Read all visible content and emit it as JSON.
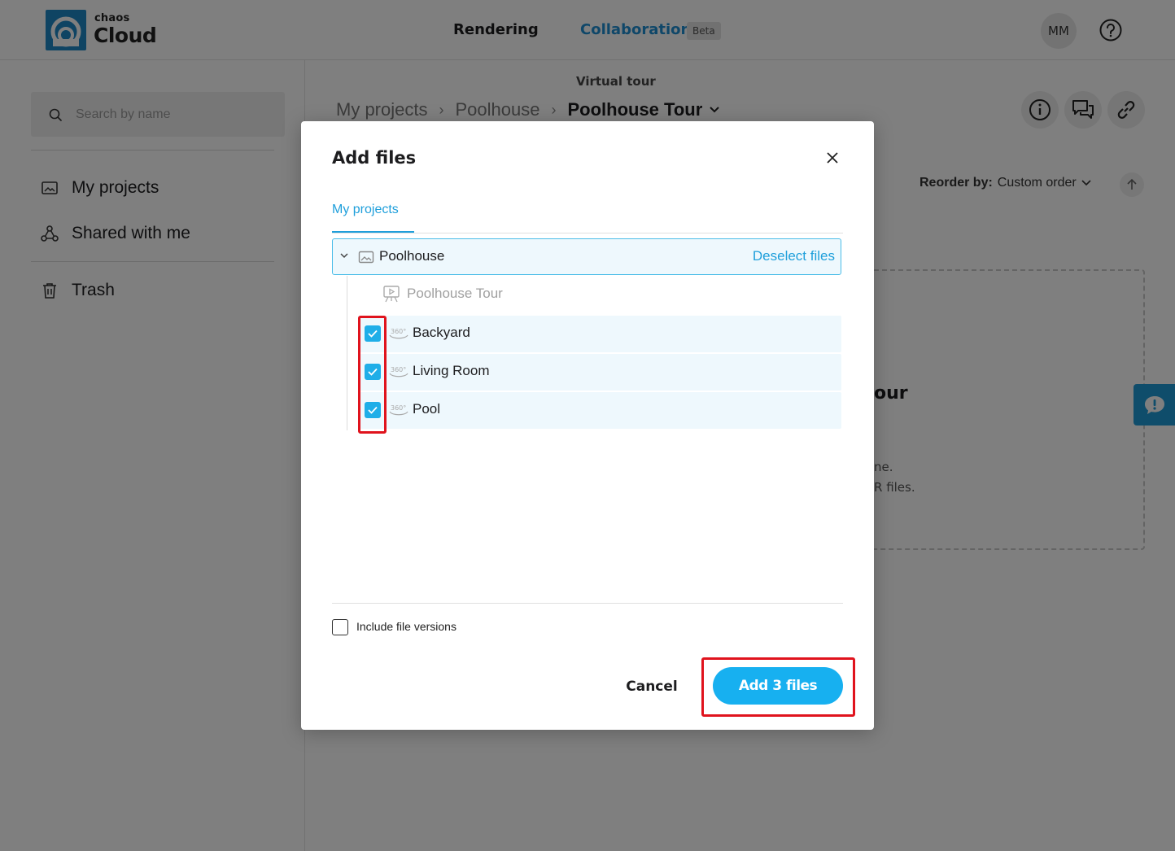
{
  "header": {
    "logo_small": "chaos",
    "logo_big": "Cloud",
    "nav_rendering": "Rendering",
    "nav_collaboration": "Collaboration",
    "beta_badge": "Beta",
    "avatar_initials": "MM",
    "help_icon": "help-circle-icon"
  },
  "sidebar": {
    "search_placeholder": "Search by name",
    "items": [
      {
        "label": "My projects",
        "icon": "image-folder-icon"
      },
      {
        "label": "Shared with me",
        "icon": "share-nodes-icon"
      },
      {
        "label": "Trash",
        "icon": "trash-icon"
      }
    ]
  },
  "main": {
    "subtitle": "Virtual tour",
    "breadcrumb": [
      "My projects",
      "Poolhouse",
      "Poolhouse Tour"
    ],
    "reorder_label": "Reorder by:",
    "reorder_value": "Custom order",
    "dropzone_title_fragment": "our",
    "dropzone_line1_fragment": "ne.",
    "dropzone_line2_fragment": "R files."
  },
  "modal": {
    "title": "Add files",
    "tab": "My projects",
    "folder": {
      "name": "Poolhouse",
      "action": "Deselect files"
    },
    "tour_item": "Poolhouse Tour",
    "files": [
      {
        "label": "Backyard",
        "checked": true
      },
      {
        "label": "Living Room",
        "checked": true
      },
      {
        "label": "Pool",
        "checked": true
      }
    ],
    "include_versions_label": "Include file versions",
    "include_versions_checked": false,
    "cancel_label": "Cancel",
    "add_label": "Add 3 files"
  },
  "colors": {
    "accent": "#17b0f0",
    "link": "#1f9fdb",
    "highlight": "#e0131d",
    "brand": "#1e88c7"
  }
}
